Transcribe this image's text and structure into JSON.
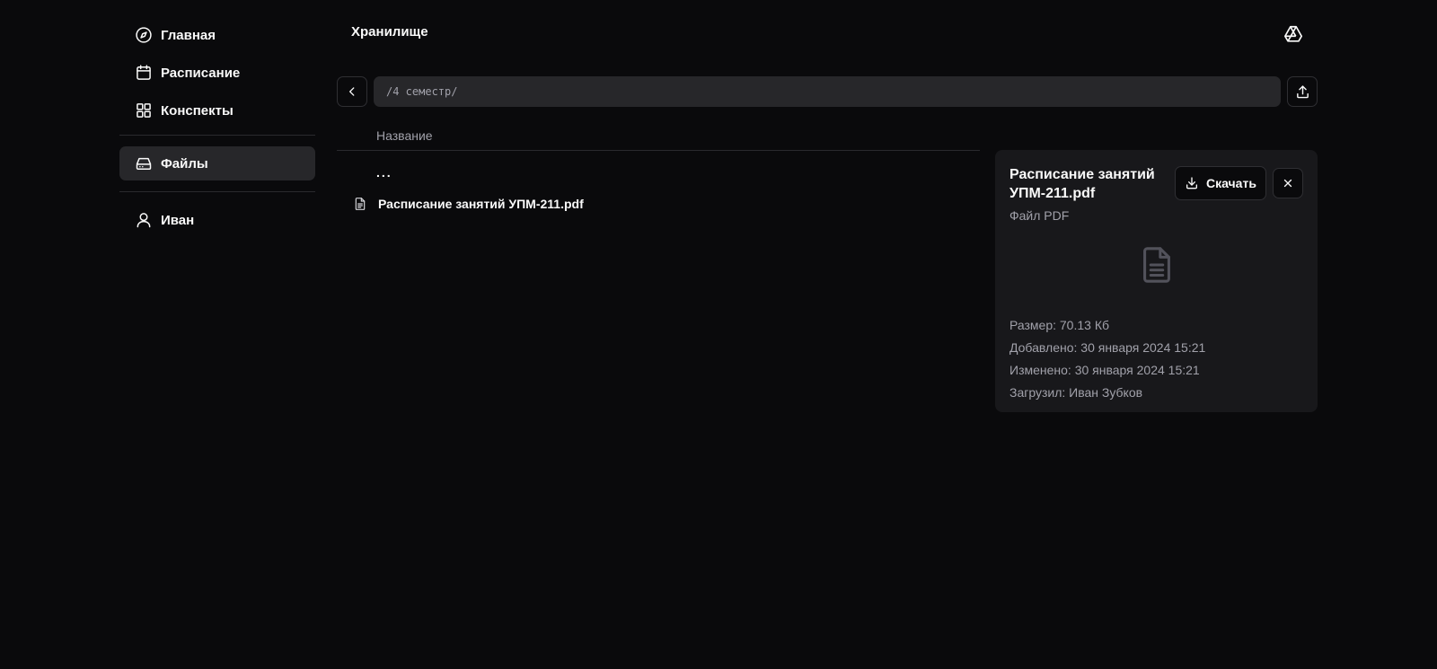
{
  "sidebar": {
    "items": [
      {
        "label": "Главная",
        "icon": "compass-icon"
      },
      {
        "label": "Расписание",
        "icon": "calendar-icon"
      },
      {
        "label": "Конспекты",
        "icon": "grid-icon"
      },
      {
        "label": "Файлы",
        "icon": "hard-drive-icon",
        "active": true
      },
      {
        "label": "Иван",
        "icon": "user-icon"
      }
    ]
  },
  "header": {
    "title": "Хранилище",
    "drive_icon": "google-drive-icon"
  },
  "toolbar": {
    "path": "/4 семестр/"
  },
  "file_list": {
    "column_name": "Название",
    "parent_label": "...",
    "files": [
      {
        "name": "Расписание занятий УПМ-211.pdf",
        "icon": "file-text-icon"
      }
    ]
  },
  "details": {
    "title": "Расписание занятий УПМ-211.pdf",
    "type": "Файл PDF",
    "download_label": "Скачать",
    "size": "Размер: 70.13 Кб",
    "added": "Добавлено: 30 января 2024 15:21",
    "modified": "Изменено: 30 января 2024 15:21",
    "uploaded_by": "Загрузил: Иван Зубков"
  },
  "colors": {
    "background": "#0a0a0c",
    "panel": "#18181b",
    "active": "#27272a",
    "muted_text": "#a1a1aa"
  }
}
